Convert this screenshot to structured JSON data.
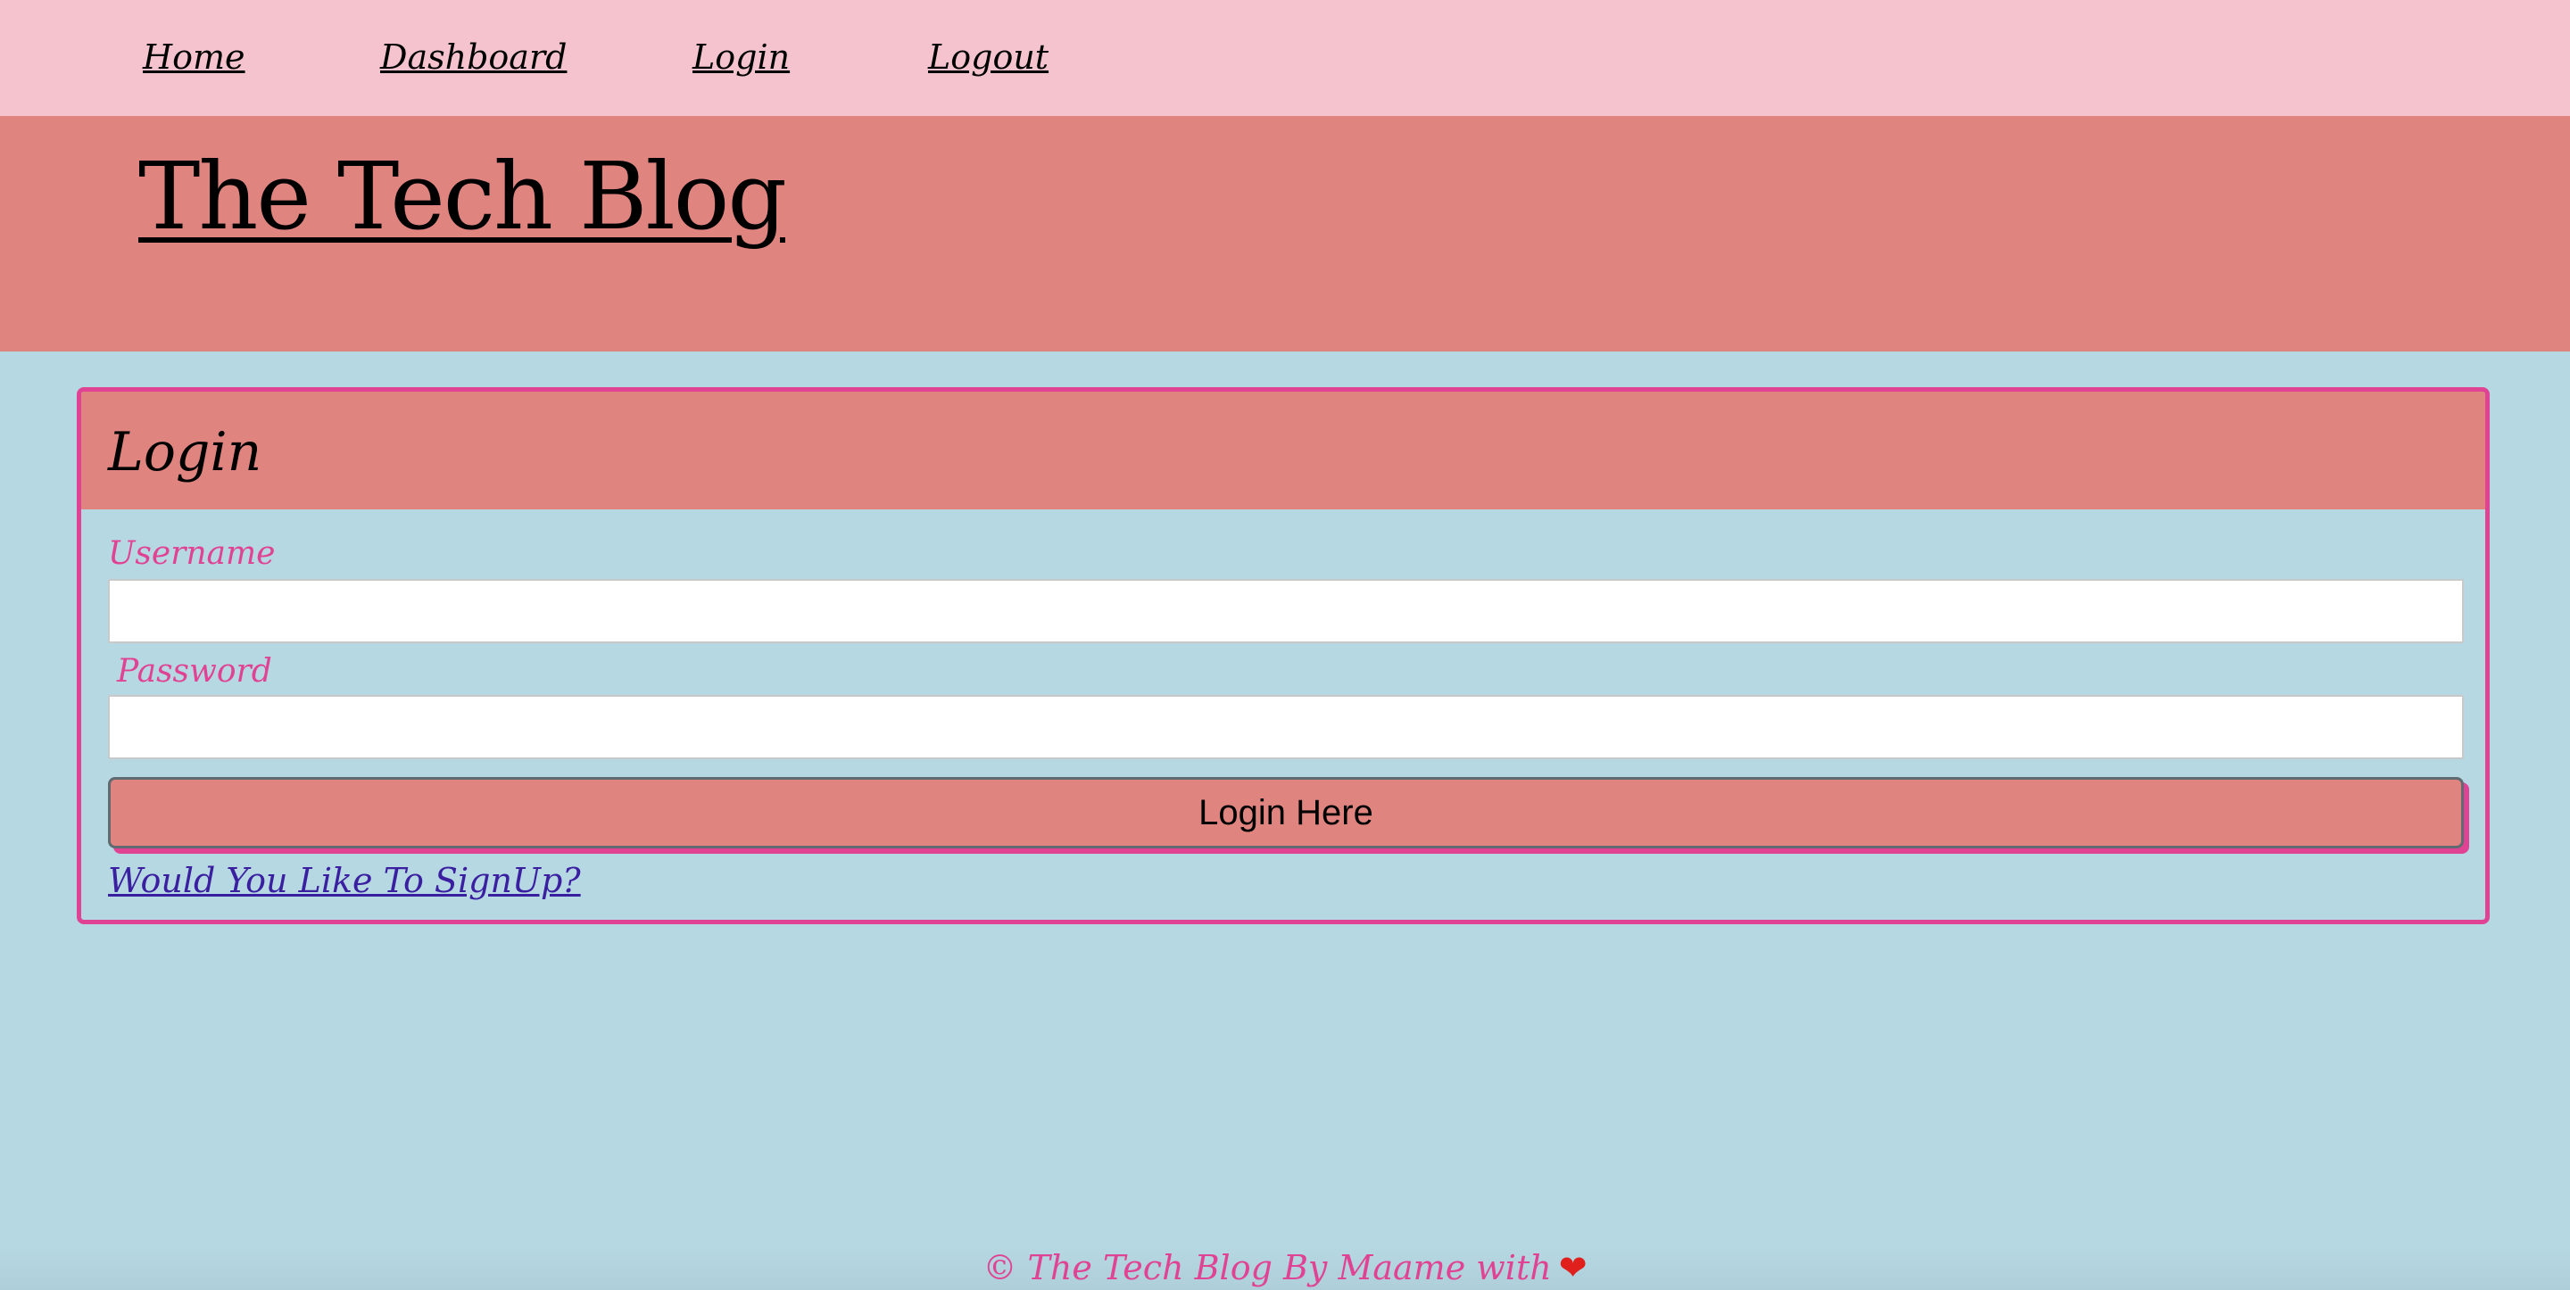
{
  "nav": {
    "items": [
      {
        "label": "Home"
      },
      {
        "label": "Dashboard"
      },
      {
        "label": "Login"
      },
      {
        "label": "Logout"
      }
    ]
  },
  "header": {
    "title": "The Tech Blog"
  },
  "login_form": {
    "title": "Login",
    "username_label": "Username",
    "username_value": "",
    "password_label": "Password",
    "password_value": "",
    "submit_label": "Login Here",
    "signup_link": "Would You Like To SignUp?"
  },
  "footer": {
    "text": "© The Tech Blog By Maame with",
    "icon": "heart-icon",
    "icon_glyph": "❤"
  },
  "colors": {
    "nav_background": "#f4c3cd",
    "banner_background": "#e08480",
    "page_background": "#b6d8e3",
    "accent_pink": "#e04393",
    "link_purple": "#3a1fa0"
  }
}
